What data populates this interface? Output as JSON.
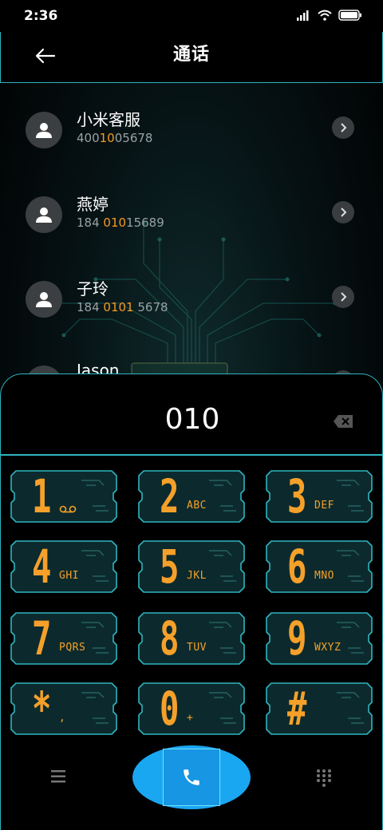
{
  "status_bar": {
    "time": "2:36"
  },
  "header": {
    "title": "通话"
  },
  "contacts": [
    {
      "name": "小米客服",
      "number_pre": "400",
      "number_hl": "10",
      "number_post": "05678"
    },
    {
      "name": "燕婷",
      "number_pre": "184 ",
      "number_hl": "010",
      "number_post": "15689"
    },
    {
      "name": "子玲",
      "number_pre": "184 ",
      "number_hl": "0101",
      "number_post": " 5678"
    },
    {
      "name": "Jason",
      "number_pre": "",
      "number_hl": "",
      "number_post": ""
    }
  ],
  "dialer": {
    "number": "010",
    "keys": [
      {
        "digit": "1",
        "letters": ""
      },
      {
        "digit": "2",
        "letters": "ABC"
      },
      {
        "digit": "3",
        "letters": "DEF"
      },
      {
        "digit": "4",
        "letters": "GHI"
      },
      {
        "digit": "5",
        "letters": "JKL"
      },
      {
        "digit": "6",
        "letters": "MNO"
      },
      {
        "digit": "7",
        "letters": "PQRS"
      },
      {
        "digit": "8",
        "letters": "TUV"
      },
      {
        "digit": "9",
        "letters": "WXYZ"
      },
      {
        "digit": "*",
        "letters": ","
      },
      {
        "digit": "0",
        "letters": "+"
      },
      {
        "digit": "#",
        "letters": ""
      }
    ]
  },
  "colors": {
    "accent": "#f5a02a",
    "frame": "#2fb4bf",
    "call": "#1aa7f2"
  },
  "icons": [
    "back-arrow-icon",
    "person-icon",
    "chevron-right-icon",
    "backspace-icon",
    "menu-icon",
    "phone-icon",
    "dialpad-icon",
    "voicemail-icon",
    "signal-icon",
    "wifi-icon",
    "battery-icon"
  ]
}
